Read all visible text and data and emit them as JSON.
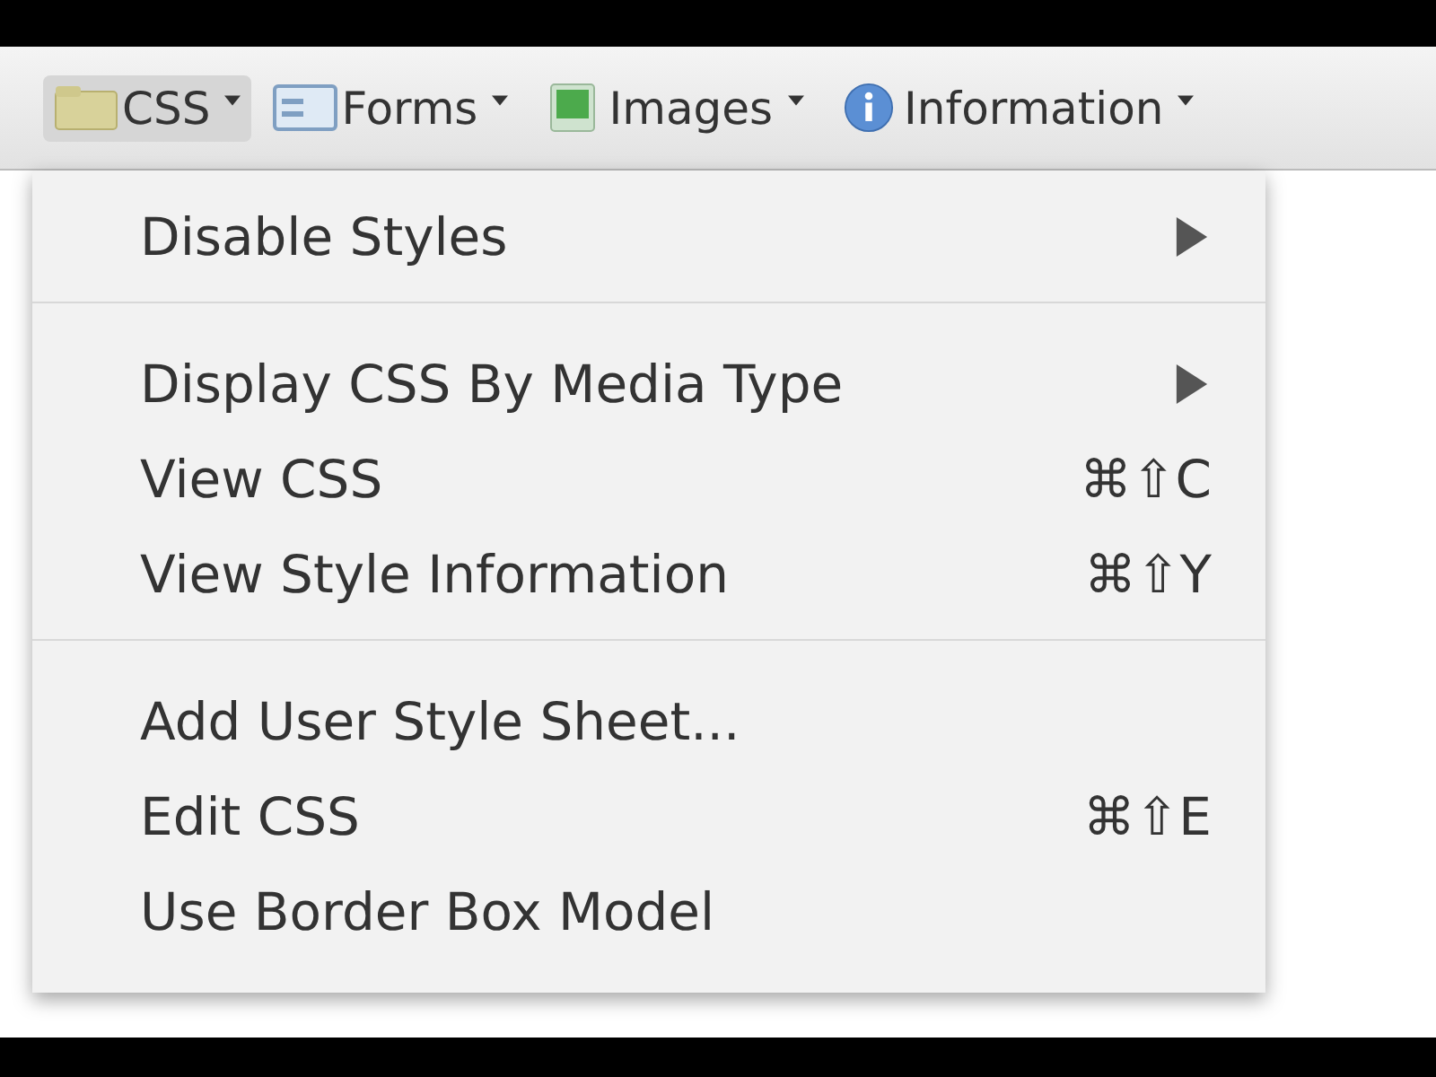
{
  "toolbar": {
    "buttons": [
      {
        "label": "CSS",
        "kind": "css",
        "selected": true
      },
      {
        "label": "Forms",
        "kind": "forms",
        "selected": false
      },
      {
        "label": "Images",
        "kind": "images",
        "selected": false
      },
      {
        "label": "Information",
        "kind": "info",
        "selected": false
      }
    ]
  },
  "menu": {
    "groups": [
      {
        "items": [
          {
            "label": "Disable Styles",
            "kind": "submenu"
          }
        ]
      },
      {
        "items": [
          {
            "label": "Display CSS By Media Type",
            "kind": "submenu"
          },
          {
            "label": "View CSS",
            "kind": "command",
            "shortcut": "⌘⇧C"
          },
          {
            "label": "View Style Information",
            "kind": "command",
            "shortcut": "⌘⇧Y"
          }
        ]
      },
      {
        "items": [
          {
            "label": "Add User Style Sheet...",
            "kind": "command"
          },
          {
            "label": "Edit CSS",
            "kind": "command",
            "shortcut": "⌘⇧E"
          },
          {
            "label": "Use Border Box Model",
            "kind": "command"
          }
        ]
      }
    ]
  }
}
